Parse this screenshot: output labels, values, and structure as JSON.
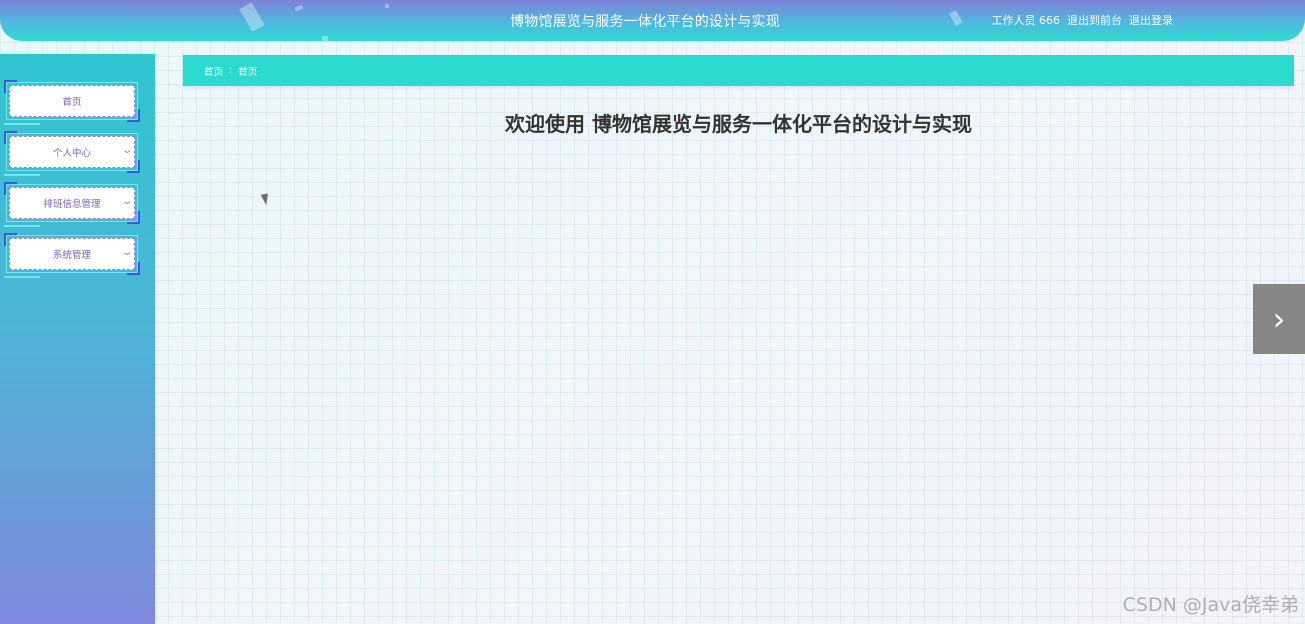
{
  "header": {
    "title": "博物馆展览与服务一体化平台的设计与实现",
    "user_label": "工作人员 666",
    "back_to_front": "退出到前台",
    "logout": "退出登录"
  },
  "sidebar": {
    "items": [
      {
        "label": "首页",
        "has_dropdown": false
      },
      {
        "label": "个人中心",
        "has_dropdown": true
      },
      {
        "label": "排班信息管理",
        "has_dropdown": true
      },
      {
        "label": "系统管理",
        "has_dropdown": true
      }
    ]
  },
  "breadcrumb": {
    "root": "首页",
    "separator": "ː",
    "current": "首页"
  },
  "main": {
    "welcome": "欢迎使用 博物馆展览与服务一体化平台的设计与实现"
  },
  "next_arrow": {
    "icon": "chevron-right-icon",
    "glyph": "›"
  },
  "watermark": "CSDN @Java侥幸弟",
  "colors": {
    "accent": "#2cdbd0",
    "menu_corner": "#3f55e6",
    "menu_text": "#7a5fc0"
  }
}
